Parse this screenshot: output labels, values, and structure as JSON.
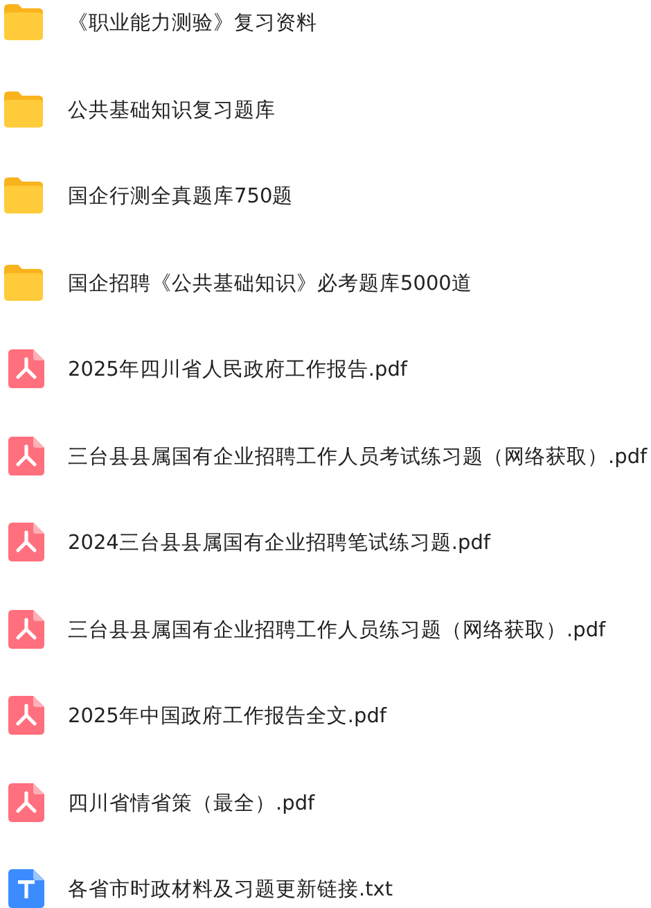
{
  "files": [
    {
      "kind": "folder",
      "name": "《职业能力测验》复习资料"
    },
    {
      "kind": "folder",
      "name": "公共基础知识复习题库"
    },
    {
      "kind": "folder",
      "name": "国企行测全真题库750题"
    },
    {
      "kind": "folder",
      "name": "国企招聘《公共基础知识》必考题库5000道"
    },
    {
      "kind": "pdf",
      "name": "2025年四川省人民政府工作报告.pdf"
    },
    {
      "kind": "pdf",
      "name": "三台县县属国有企业招聘工作人员考试练习题（网络获取）.pdf"
    },
    {
      "kind": "pdf",
      "name": "2024三台县县属国有企业招聘笔试练习题.pdf"
    },
    {
      "kind": "pdf",
      "name": "三台县县属国有企业招聘工作人员练习题（网络获取）.pdf"
    },
    {
      "kind": "pdf",
      "name": "2025年中国政府工作报告全文.pdf"
    },
    {
      "kind": "pdf",
      "name": "四川省情省策（最全）.pdf"
    },
    {
      "kind": "txt",
      "name": "各省市时政材料及习题更新链接.txt"
    }
  ]
}
